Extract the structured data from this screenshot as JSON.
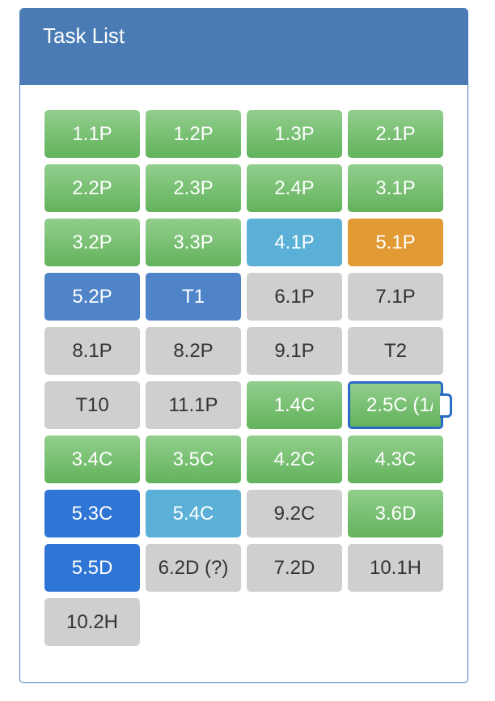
{
  "panel": {
    "title": "Task List"
  },
  "colors": {
    "header": "#4a7bb5",
    "complete": "#6fbb69",
    "discuss": "#5ab0d7",
    "fix_and_resubmit": "#e29a35",
    "ready_for_feedback": "#4f84c9",
    "working_on_it": "#2f75d6",
    "not_started": "#cfcfcf",
    "selected_border": "#2a6bc9"
  },
  "tasks": [
    {
      "label": "1.1P"
    },
    {
      "label": "1.2P"
    },
    {
      "label": "1.3P"
    },
    {
      "label": "2.1P"
    },
    {
      "label": "2.2P"
    },
    {
      "label": "2.3P"
    },
    {
      "label": "2.4P"
    },
    {
      "label": "3.1P"
    },
    {
      "label": "3.2P"
    },
    {
      "label": "3.3P"
    },
    {
      "label": "4.1P"
    },
    {
      "label": "5.1P"
    },
    {
      "label": "5.2P"
    },
    {
      "label": "T1"
    },
    {
      "label": "6.1P"
    },
    {
      "label": "7.1P"
    },
    {
      "label": "8.1P"
    },
    {
      "label": "8.2P"
    },
    {
      "label": "9.1P"
    },
    {
      "label": "T2"
    },
    {
      "label": "T10"
    },
    {
      "label": "11.1P"
    },
    {
      "label": "1.4C"
    },
    {
      "label": "2.5C (1/"
    },
    {
      "label": "3.4C"
    },
    {
      "label": "3.5C"
    },
    {
      "label": "4.2C"
    },
    {
      "label": "4.3C"
    },
    {
      "label": "5.3C"
    },
    {
      "label": "5.4C"
    },
    {
      "label": "9.2C"
    },
    {
      "label": "3.6D"
    },
    {
      "label": "5.5D"
    },
    {
      "label": "6.2D (?)"
    },
    {
      "label": "7.2D"
    },
    {
      "label": "10.1H"
    },
    {
      "label": "10.2H"
    }
  ]
}
